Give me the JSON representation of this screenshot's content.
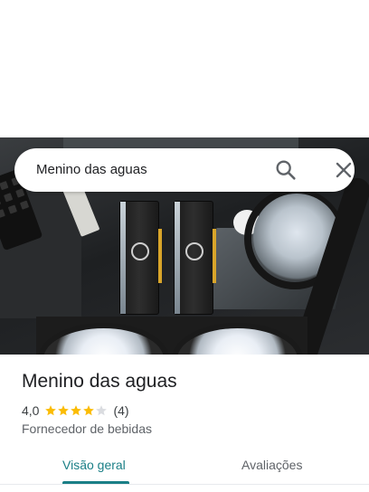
{
  "search": {
    "query": "Menino das aguas"
  },
  "place": {
    "name": "Menino das aguas",
    "rating": "4,0",
    "rating_value": 4.0,
    "rating_max": 5,
    "review_count": "(4)",
    "category": "Fornecedor de bebidas"
  },
  "tabs": [
    {
      "label": "Visão geral",
      "active": true
    },
    {
      "label": "Avaliações",
      "active": false
    }
  ],
  "colors": {
    "accent": "#1a7f86",
    "star": "#fbbc04",
    "star_empty": "#dadce0"
  },
  "icons": {
    "search": "search-icon",
    "close": "close-icon",
    "star": "star-icon"
  }
}
